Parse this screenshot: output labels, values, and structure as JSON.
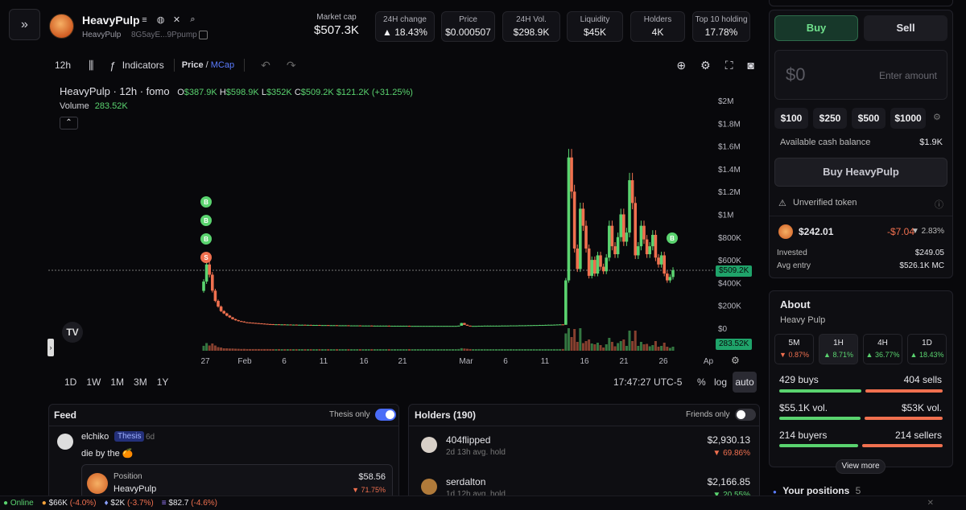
{
  "token": {
    "name": "HeavyPulp",
    "ticker": "HeavyPulp",
    "address": "8G5ayE...9Ppump"
  },
  "header": {
    "market_cap_label": "Market cap",
    "market_cap": "$507.3K",
    "stats": [
      {
        "label": "24H change",
        "value": "▲ 18.43%",
        "positive": true
      },
      {
        "label": "Price",
        "value": "$0.000507"
      },
      {
        "label": "24H Vol.",
        "value": "$298.9K"
      },
      {
        "label": "Liquidity",
        "value": "$45K"
      },
      {
        "label": "Holders",
        "value": "4K"
      },
      {
        "label": "Top 10 holding",
        "value": "17.78%"
      }
    ]
  },
  "toolbar": {
    "interval": "12h",
    "indicators": "Indicators",
    "price_label": "Price",
    "slash": "/",
    "mcap_label": "MCap"
  },
  "chart_legend": {
    "title": "HeavyPulp · 12h · fomo",
    "o_label": "O",
    "o": "$387.9K",
    "h_label": "H",
    "h": "$598.9K",
    "l_label": "L",
    "l": "$352K",
    "c_label": "C",
    "c": "$509.2K",
    "change": "$121.2K (+31.25%)",
    "volume_label": "Volume",
    "volume": "283.52K"
  },
  "chart_data": {
    "type": "candlestick",
    "y_ticks": [
      "$2M",
      "$1.8M",
      "$1.6M",
      "$1.4M",
      "$1.2M",
      "$1M",
      "$800K",
      "$600K",
      "$400K",
      "$200K",
      "$0"
    ],
    "ylim": [
      0,
      2000
    ],
    "y_unit": "K",
    "x_ticks": [
      "27",
      "Feb",
      "6",
      "11",
      "16",
      "21",
      "Mar",
      "6",
      "11",
      "16",
      "21",
      "26",
      "Ap"
    ],
    "last_price_label": "$509.2K",
    "last_volume_label": "283.52K",
    "markers": [
      "B",
      "B",
      "B",
      "S",
      "B"
    ],
    "close_series": [
      410,
      560,
      470,
      330,
      240,
      190,
      150,
      130,
      110,
      95,
      80,
      70,
      62,
      58,
      52,
      50,
      48,
      46,
      44,
      42,
      40,
      38,
      36,
      35,
      34,
      34,
      33,
      33,
      32,
      32,
      31,
      31,
      30,
      30,
      30,
      29,
      29,
      28,
      28,
      28,
      27,
      27,
      27,
      26,
      26,
      26,
      25,
      25,
      25,
      25,
      24,
      24,
      24,
      24,
      23,
      23,
      23,
      23,
      22,
      22,
      22,
      22,
      22,
      22,
      21,
      21,
      21,
      21,
      21,
      21,
      21,
      20,
      20,
      20,
      20,
      20,
      20,
      20,
      20,
      20,
      20,
      20,
      20,
      20,
      20,
      20,
      20,
      20,
      22,
      45,
      30,
      22,
      20,
      20,
      20,
      21,
      21,
      22,
      22,
      22,
      22,
      22,
      22,
      23,
      23,
      23,
      24,
      24,
      24,
      25,
      25,
      25,
      26,
      26,
      27,
      27,
      28,
      28,
      29,
      30,
      30,
      31,
      32,
      33,
      30,
      420,
      1500,
      1200,
      700,
      520,
      1050,
      900,
      700,
      460,
      600,
      480,
      640,
      540,
      500,
      620,
      900,
      720,
      650,
      800,
      1000,
      760,
      840,
      1300,
      1100,
      640,
      720,
      900,
      780,
      650,
      720,
      820,
      620,
      560,
      640,
      480,
      420,
      450,
      510
    ],
    "volume_note": "Volume bars shown under price"
  },
  "time_buttons": [
    "1D",
    "1W",
    "1M",
    "3M",
    "1Y"
  ],
  "clock": "17:47:27 UTC-5",
  "scale_buttons": [
    "%",
    "log",
    "auto"
  ],
  "feed": {
    "title": "Feed",
    "toggle_label": "Thesis only",
    "post_user": "elchiko",
    "post_tag": "Thesis",
    "post_age": "6d",
    "post_text": "die by the 🍊",
    "position_label": "Position",
    "position_token": "HeavyPulp",
    "position_value": "$58.56",
    "position_change": "▼ 71.75%"
  },
  "holders": {
    "title": "Holders (190)",
    "toggle_label": "Friends only",
    "rows": [
      {
        "name": "404flipped",
        "hold": "2d 13h avg. hold",
        "value": "$2,930.13",
        "change": "▼ 69.86%"
      },
      {
        "name": "serdalton",
        "hold": "1d 12h avg. hold",
        "value": "$2,166.85",
        "change": "▼ 20.55%"
      }
    ]
  },
  "trade": {
    "buy_tab": "Buy",
    "sell_tab": "Sell",
    "amount_value": "$0",
    "amount_placeholder": "Enter amount",
    "presets": [
      "$100",
      "$250",
      "$500",
      "$1000"
    ],
    "cash_label": "Available cash balance",
    "cash_value": "$1.9K",
    "buy_button": "Buy HeavyPulp",
    "unverified": "Unverified token",
    "position_value": "$242.01",
    "position_pnl": "-$7.04",
    "position_pct": "▼ 2.83%",
    "invested_label": "Invested",
    "invested_value": "$249.05",
    "avg_label": "Avg entry",
    "avg_value": "$526.1K MC"
  },
  "about": {
    "title": "About",
    "subtitle": "Heavy Pulp",
    "timeframes": [
      {
        "label": "5M",
        "value": "▼ 0.87%",
        "positive": false
      },
      {
        "label": "1H",
        "value": "▲ 8.71%",
        "positive": true
      },
      {
        "label": "4H",
        "value": "▲ 36.77%",
        "positive": true
      },
      {
        "label": "1D",
        "value": "▲ 18.43%",
        "positive": true
      }
    ],
    "buys": "429 buys",
    "sells": "404 sells",
    "buy_vol": "$55.1K vol.",
    "sell_vol": "$53K vol.",
    "buyers": "214 buyers",
    "sellers": "214 sellers",
    "view_more": "View more",
    "your_positions_label": "Your positions",
    "your_positions_count": "5"
  },
  "status": {
    "online": "Online",
    "btc": "$66K",
    "btc_change": "(-4.0%)",
    "eth": "$2K",
    "eth_change": "(-3.7%)",
    "sol": "$82.7",
    "sol_change": "(-4.6%)"
  },
  "colors": {
    "up": "#5ad36f",
    "down": "#f0704f",
    "accent": "#4a6cf7"
  }
}
